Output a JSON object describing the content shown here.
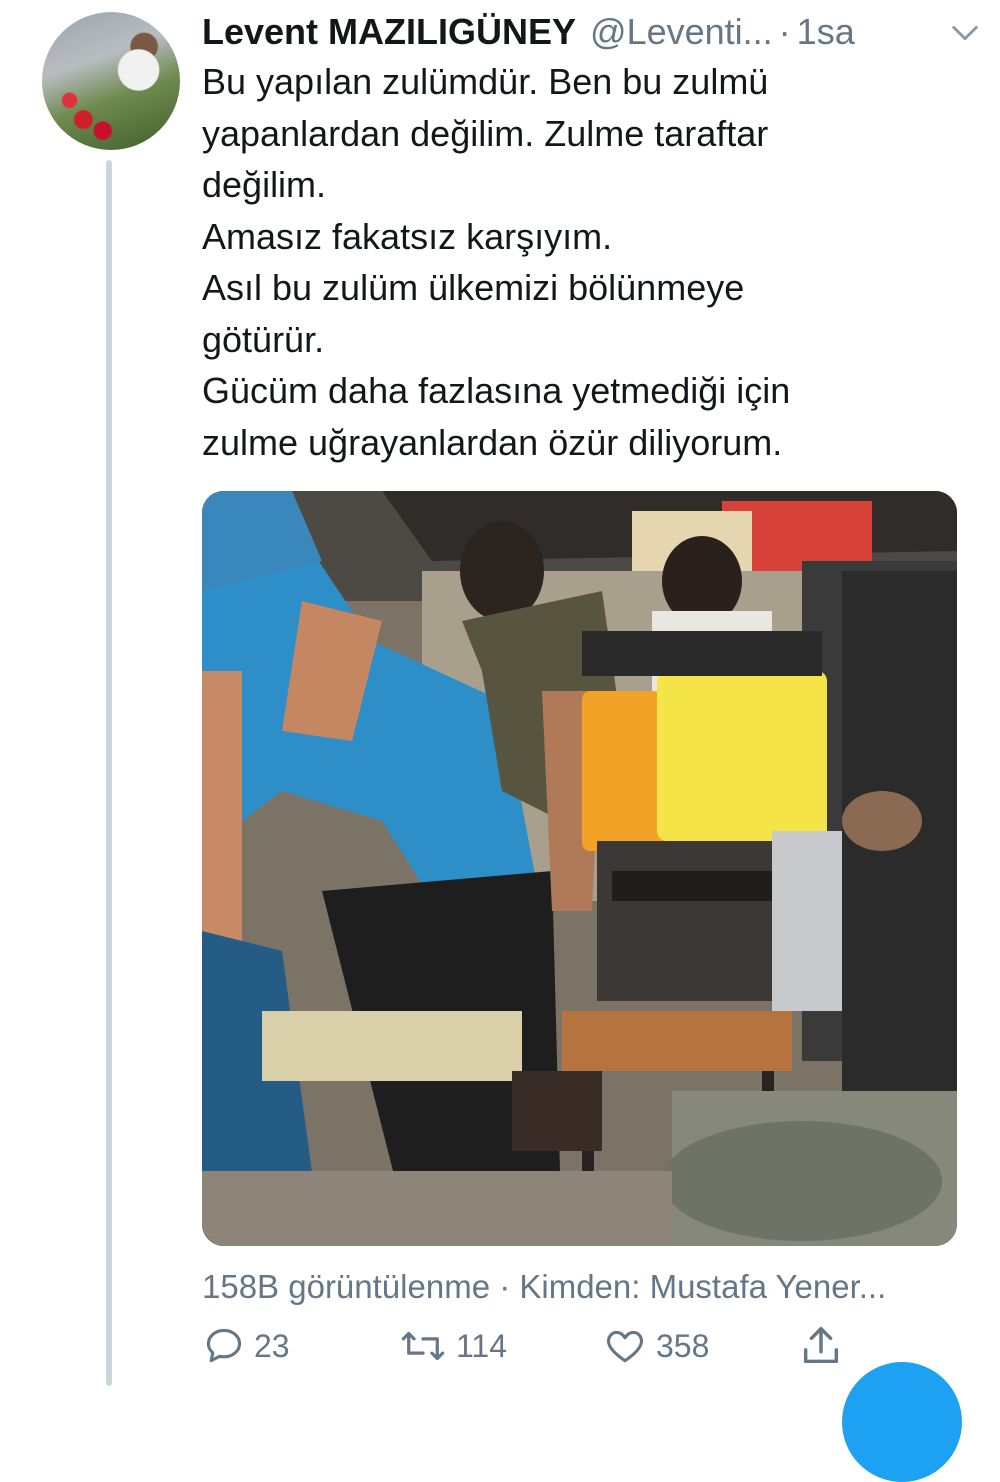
{
  "tweet": {
    "author_name": "Levent MAZILIGÜNEY",
    "handle": "@Leventi...",
    "separator": "·",
    "time": "1sa",
    "text_lines": [
      "Bu yapılan zulümdür. Ben bu zulmü",
      "yapanlardan değilim. Zulme taraftar",
      "değilim.",
      "Amasız fakatsız karşıyım.",
      "Asıl bu zulüm ülkemizi bölünmeye",
      "götürür.",
      "Gücüm daha fazlasına yetmediği için",
      "zulme uğrayanlardan özür diliyorum."
    ],
    "meta": "158B görüntülenme · Kimden: Mustafa Yener..."
  },
  "actions": {
    "reply_count": "23",
    "retweet_count": "114",
    "like_count": "358"
  },
  "icons": {
    "menu": "chevron-down-icon",
    "reply": "reply-icon",
    "retweet": "retweet-icon",
    "like": "heart-icon",
    "share": "share-icon"
  },
  "colors": {
    "text": "#14171a",
    "secondary": "#657786",
    "thread_line": "#ccd6dd",
    "accent": "#1da1f2"
  }
}
